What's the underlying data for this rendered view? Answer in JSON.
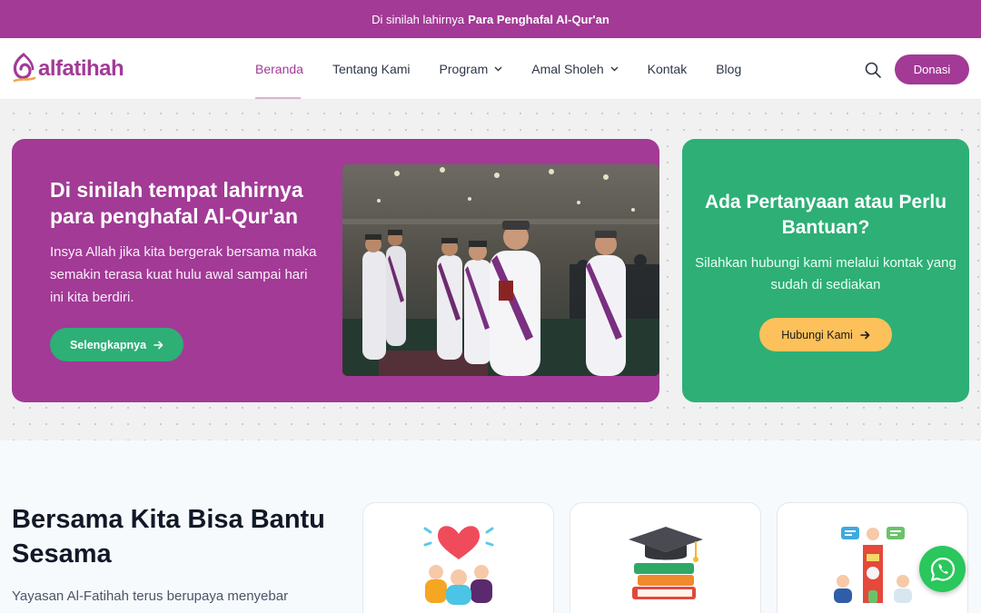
{
  "announcement": {
    "prefix": "Di sinilah lahirnya",
    "highlight": "Para Penghafal Al-Qur'an"
  },
  "brand": {
    "name": "alfatihah",
    "color": "#a23a96"
  },
  "nav": {
    "items": [
      {
        "label": "Beranda",
        "active": true
      },
      {
        "label": "Tentang Kami"
      },
      {
        "label": "Program",
        "dropdown": true
      },
      {
        "label": "Amal Sholeh",
        "dropdown": true
      },
      {
        "label": "Kontak"
      },
      {
        "label": "Blog"
      }
    ],
    "donate_label": "Donasi",
    "search_icon": "search-icon"
  },
  "hero": {
    "title": "Di sinilah tempat lahirnya para penghafal Al-Qur'an",
    "text": "Insya Allah jika kita bergerak bersama maka semakin terasa kuat hulu awal sampai hari ini kita berdiri.",
    "button_label": "Selengkapnya",
    "photo": "students-in-white-robes-photo",
    "color": "#a23a96"
  },
  "help": {
    "title": "Ada Pertanyaan atau Perlu Bantuan?",
    "text": "Silahkan hubungi kami melalui kontak yang sudah di sediakan",
    "button_label": "Hubungi Kami",
    "color": "#2daf76",
    "button_color": "#fcc15a"
  },
  "section": {
    "title": "Bersama Kita Bisa Bantu Sesama",
    "text": "Yayasan Al-Fatihah terus berupaya menyebar"
  },
  "features": [
    {
      "icon": "charity-heart-icon"
    },
    {
      "icon": "graduation-books-icon"
    },
    {
      "icon": "mosque-community-icon"
    }
  ],
  "whatsapp": {
    "icon": "whatsapp-icon",
    "color": "#29c75c"
  }
}
